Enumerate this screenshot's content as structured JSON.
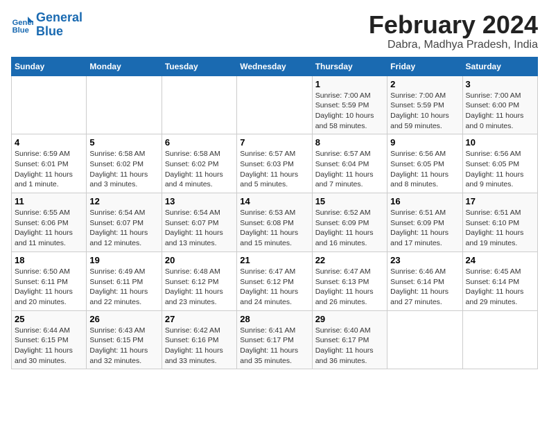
{
  "header": {
    "logo_line1": "General",
    "logo_line2": "Blue",
    "month_title": "February 2024",
    "subtitle": "Dabra, Madhya Pradesh, India"
  },
  "days_of_week": [
    "Sunday",
    "Monday",
    "Tuesday",
    "Wednesday",
    "Thursday",
    "Friday",
    "Saturday"
  ],
  "weeks": [
    [
      {
        "day": "",
        "info": ""
      },
      {
        "day": "",
        "info": ""
      },
      {
        "day": "",
        "info": ""
      },
      {
        "day": "",
        "info": ""
      },
      {
        "day": "1",
        "info": "Sunrise: 7:00 AM\nSunset: 5:59 PM\nDaylight: 10 hours\nand 58 minutes."
      },
      {
        "day": "2",
        "info": "Sunrise: 7:00 AM\nSunset: 5:59 PM\nDaylight: 10 hours\nand 59 minutes."
      },
      {
        "day": "3",
        "info": "Sunrise: 7:00 AM\nSunset: 6:00 PM\nDaylight: 11 hours\nand 0 minutes."
      }
    ],
    [
      {
        "day": "4",
        "info": "Sunrise: 6:59 AM\nSunset: 6:01 PM\nDaylight: 11 hours\nand 1 minute."
      },
      {
        "day": "5",
        "info": "Sunrise: 6:58 AM\nSunset: 6:02 PM\nDaylight: 11 hours\nand 3 minutes."
      },
      {
        "day": "6",
        "info": "Sunrise: 6:58 AM\nSunset: 6:02 PM\nDaylight: 11 hours\nand 4 minutes."
      },
      {
        "day": "7",
        "info": "Sunrise: 6:57 AM\nSunset: 6:03 PM\nDaylight: 11 hours\nand 5 minutes."
      },
      {
        "day": "8",
        "info": "Sunrise: 6:57 AM\nSunset: 6:04 PM\nDaylight: 11 hours\nand 7 minutes."
      },
      {
        "day": "9",
        "info": "Sunrise: 6:56 AM\nSunset: 6:05 PM\nDaylight: 11 hours\nand 8 minutes."
      },
      {
        "day": "10",
        "info": "Sunrise: 6:56 AM\nSunset: 6:05 PM\nDaylight: 11 hours\nand 9 minutes."
      }
    ],
    [
      {
        "day": "11",
        "info": "Sunrise: 6:55 AM\nSunset: 6:06 PM\nDaylight: 11 hours\nand 11 minutes."
      },
      {
        "day": "12",
        "info": "Sunrise: 6:54 AM\nSunset: 6:07 PM\nDaylight: 11 hours\nand 12 minutes."
      },
      {
        "day": "13",
        "info": "Sunrise: 6:54 AM\nSunset: 6:07 PM\nDaylight: 11 hours\nand 13 minutes."
      },
      {
        "day": "14",
        "info": "Sunrise: 6:53 AM\nSunset: 6:08 PM\nDaylight: 11 hours\nand 15 minutes."
      },
      {
        "day": "15",
        "info": "Sunrise: 6:52 AM\nSunset: 6:09 PM\nDaylight: 11 hours\nand 16 minutes."
      },
      {
        "day": "16",
        "info": "Sunrise: 6:51 AM\nSunset: 6:09 PM\nDaylight: 11 hours\nand 17 minutes."
      },
      {
        "day": "17",
        "info": "Sunrise: 6:51 AM\nSunset: 6:10 PM\nDaylight: 11 hours\nand 19 minutes."
      }
    ],
    [
      {
        "day": "18",
        "info": "Sunrise: 6:50 AM\nSunset: 6:11 PM\nDaylight: 11 hours\nand 20 minutes."
      },
      {
        "day": "19",
        "info": "Sunrise: 6:49 AM\nSunset: 6:11 PM\nDaylight: 11 hours\nand 22 minutes."
      },
      {
        "day": "20",
        "info": "Sunrise: 6:48 AM\nSunset: 6:12 PM\nDaylight: 11 hours\nand 23 minutes."
      },
      {
        "day": "21",
        "info": "Sunrise: 6:47 AM\nSunset: 6:12 PM\nDaylight: 11 hours\nand 24 minutes."
      },
      {
        "day": "22",
        "info": "Sunrise: 6:47 AM\nSunset: 6:13 PM\nDaylight: 11 hours\nand 26 minutes."
      },
      {
        "day": "23",
        "info": "Sunrise: 6:46 AM\nSunset: 6:14 PM\nDaylight: 11 hours\nand 27 minutes."
      },
      {
        "day": "24",
        "info": "Sunrise: 6:45 AM\nSunset: 6:14 PM\nDaylight: 11 hours\nand 29 minutes."
      }
    ],
    [
      {
        "day": "25",
        "info": "Sunrise: 6:44 AM\nSunset: 6:15 PM\nDaylight: 11 hours\nand 30 minutes."
      },
      {
        "day": "26",
        "info": "Sunrise: 6:43 AM\nSunset: 6:15 PM\nDaylight: 11 hours\nand 32 minutes."
      },
      {
        "day": "27",
        "info": "Sunrise: 6:42 AM\nSunset: 6:16 PM\nDaylight: 11 hours\nand 33 minutes."
      },
      {
        "day": "28",
        "info": "Sunrise: 6:41 AM\nSunset: 6:17 PM\nDaylight: 11 hours\nand 35 minutes."
      },
      {
        "day": "29",
        "info": "Sunrise: 6:40 AM\nSunset: 6:17 PM\nDaylight: 11 hours\nand 36 minutes."
      },
      {
        "day": "",
        "info": ""
      },
      {
        "day": "",
        "info": ""
      }
    ]
  ]
}
